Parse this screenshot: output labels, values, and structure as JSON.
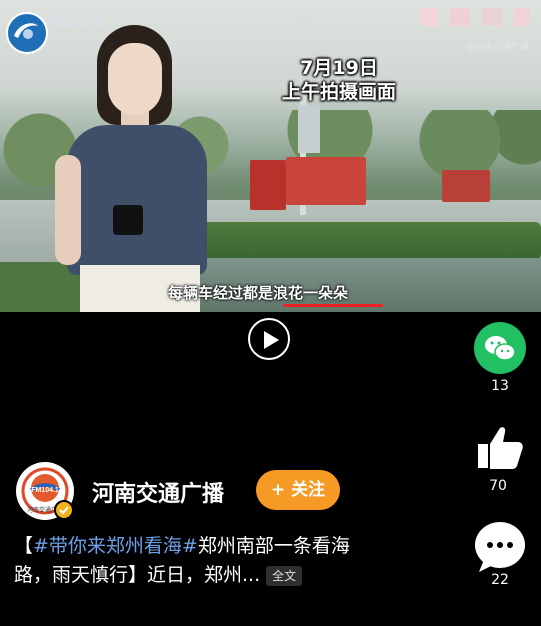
{
  "video": {
    "caption_top_line1": "7月19日",
    "caption_top_line2": "上午拍摄画面",
    "subtitle": "每辆车经过都是浪花一朵朵",
    "watermark": "@河南交通广播",
    "brand_line1": "河南交通广播",
    "brand_line2": ""
  },
  "rail": {
    "share_count": "13",
    "like_count": "70",
    "comment_count": "22"
  },
  "account": {
    "name": "河南交通广播",
    "avatar_text": "FM104.1",
    "avatar_subtext": "河南交通广播",
    "follow_label": "+ 关注"
  },
  "description": {
    "open_bracket": "【",
    "hashtag": "#带你来郑州看海#",
    "text_line1": "郑州南部一条看海",
    "text_line2": "路，雨天慎行】近日，郑州...",
    "fulltext_label": "全文"
  },
  "colors": {
    "follow_bg": "#f59a25",
    "wechat_green": "#21c063",
    "hashtag_blue": "#6da0e8",
    "underline_red": "#e22222"
  }
}
